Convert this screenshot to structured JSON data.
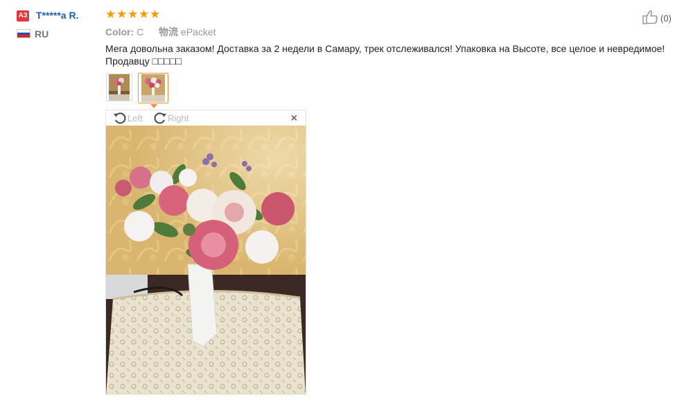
{
  "reviewer": {
    "level_badge": "A3",
    "name": "T*****a R.",
    "country": "RU",
    "flag_colors": [
      "#ffffff",
      "#2a4bb8",
      "#d52b1e"
    ]
  },
  "review": {
    "rating": 5,
    "stars": [
      "★",
      "★",
      "★",
      "★",
      "★"
    ],
    "color_label": "Color:",
    "color_value": "C",
    "shipping_label": "物流",
    "shipping_value": "ePacket",
    "text": "Мега довольна заказом! Доставка за 2 недели в Самару, трек отслеживался! Упаковка на Высоте, все целое и невредимое! Продавцу □□□□□",
    "helpful_count": "(0)"
  },
  "photos": {
    "thumbnails": [
      "photo-1",
      "photo-2"
    ],
    "active_index": 1,
    "viewer": {
      "rotate_left_label": "Left",
      "rotate_right_label": "Right",
      "close_label": "×"
    }
  },
  "icons": {
    "thumbs_up": "thumbs-up-icon",
    "rotate_left": "rotate-left-icon",
    "rotate_right": "rotate-right-icon",
    "close": "close-icon",
    "star": "star-icon"
  },
  "colors": {
    "accent_orange": "#ff8b3d",
    "star": "#ff9900",
    "username": "#1f5cb8",
    "badge": "#e4393c"
  }
}
